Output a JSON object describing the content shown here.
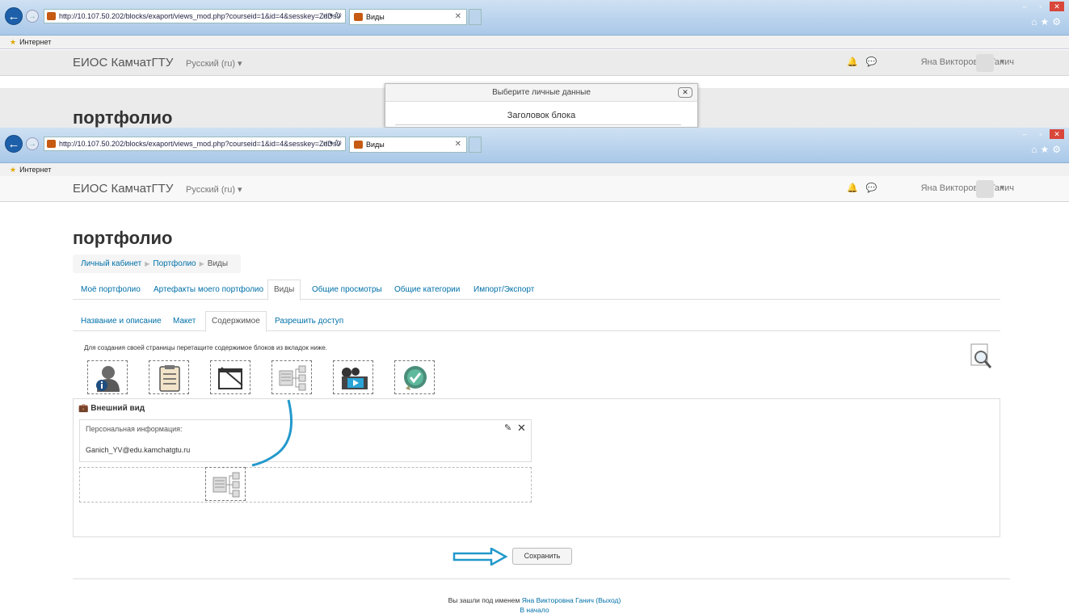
{
  "browser": {
    "url": "http://10.107.50.202/blocks/exaport/views_mod.php?courseid=1&id=4&sesskey=ZdDs9",
    "tab_title": "Виды",
    "favorites_label": "Интернет"
  },
  "site": {
    "brand": "ЕИОС КамчатГТУ",
    "language": "Русский (ru) ▾",
    "user_name": "Яна Викторовна Ганич"
  },
  "dialog": {
    "title": "Выберите личные данные",
    "field_label": "Заголовок блока"
  },
  "page": {
    "heading": "портфолио",
    "breadcrumb": [
      "Личный кабинет",
      "Портфолио",
      "Виды"
    ]
  },
  "main_tabs": [
    "Моё портфолио",
    "Артефакты моего портфолио",
    "Виды",
    "Общие просмотры",
    "Общие категории",
    "Импорт/Экспорт"
  ],
  "sub_tabs": [
    "Название и описание",
    "Макет",
    "Содержимое",
    "Разрешить доступ"
  ],
  "instruction": "Для создания своей страницы перетащите содержимое блоков из вкладок ниже.",
  "blocks": [
    "personal-info-icon",
    "list-icon",
    "note-icon",
    "tree-icon",
    "media-icon",
    "badge-icon"
  ],
  "layout": {
    "title": "Внешний вид",
    "personal_label": "Персональная информация:",
    "personal_value": "Ganich_YV@edu.kamchatgtu.ru"
  },
  "save_label": "Сохранить",
  "footer": {
    "logged_in_prefix": "Вы зашли под именем",
    "user_link": "Яна Викторовна Ганич",
    "logout": "(Выход)",
    "home": "В начало"
  }
}
